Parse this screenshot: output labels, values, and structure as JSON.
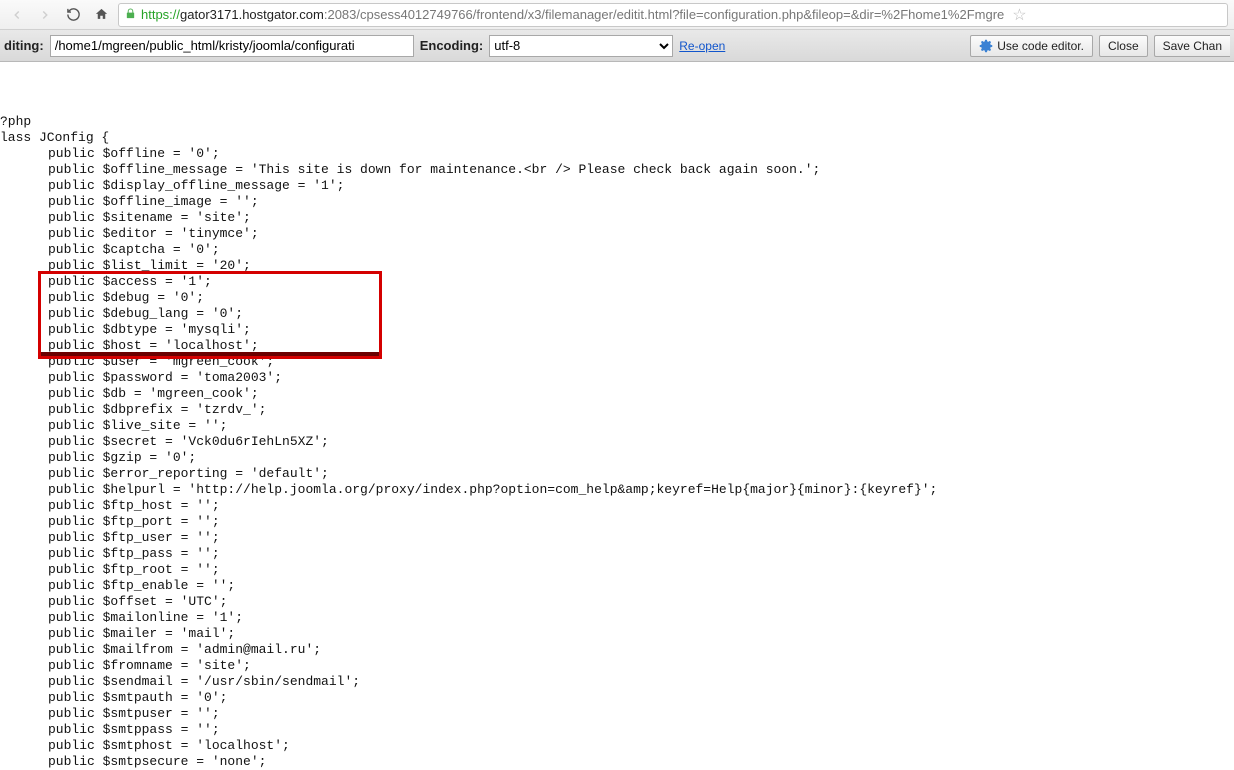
{
  "browser": {
    "url_protocol": "https://",
    "url_host": "gator3171.hostgator.com",
    "url_path": ":2083/cpsess4012749766/frontend/x3/filemanager/editit.html?file=configuration.php&fileop=&dir=%2Fhome1%2Fmgre"
  },
  "toolbar": {
    "editing_label": "diting:",
    "path_value": "/home1/mgreen/public_html/kristy/joomla/configurati",
    "encoding_label": "Encoding:",
    "encoding_value": "utf-8",
    "reopen_label": "Re-open",
    "use_code_editor_label": "Use code editor.",
    "close_label": "Close",
    "save_label": "Save Chan"
  },
  "code": {
    "lines": [
      "?php",
      "lass JConfig {",
      "public $offline = '0';",
      "public $offline_message = 'This site is down for maintenance.<br /> Please check back again soon.';",
      "public $display_offline_message = '1';",
      "public $offline_image = '';",
      "public $sitename = 'site';",
      "public $editor = 'tinymce';",
      "public $captcha = '0';",
      "public $list_limit = '20';",
      "public $access = '1';",
      "public $debug = '0';",
      "public $debug_lang = '0';",
      "public $dbtype = 'mysqli';",
      "public $host = 'localhost';",
      "public $user = 'mgreen_cook';",
      "public $password = 'toma2003';",
      "public $db = 'mgreen_cook';",
      "public $dbprefix = 'tzrdv_';",
      "public $live_site = '';",
      "public $secret = 'Vck0du6rIehLn5XZ';",
      "public $gzip = '0';",
      "public $error_reporting = 'default';",
      "public $helpurl = 'http://help.joomla.org/proxy/index.php?option=com_help&amp;keyref=Help{major}{minor}:{keyref}';",
      "public $ftp_host = '';",
      "public $ftp_port = '';",
      "public $ftp_user = '';",
      "public $ftp_pass = '';",
      "public $ftp_root = '';",
      "public $ftp_enable = '';",
      "public $offset = 'UTC';",
      "public $mailonline = '1';",
      "public $mailer = 'mail';",
      "public $mailfrom = 'admin@mail.ru';",
      "public $fromname = 'site';",
      "public $sendmail = '/usr/sbin/sendmail';",
      "public $smtpauth = '0';",
      "public $smtpuser = '';",
      "public $smtppass = '';",
      "public $smtphost = 'localhost';",
      "public $smtpsecure = 'none';"
    ]
  }
}
